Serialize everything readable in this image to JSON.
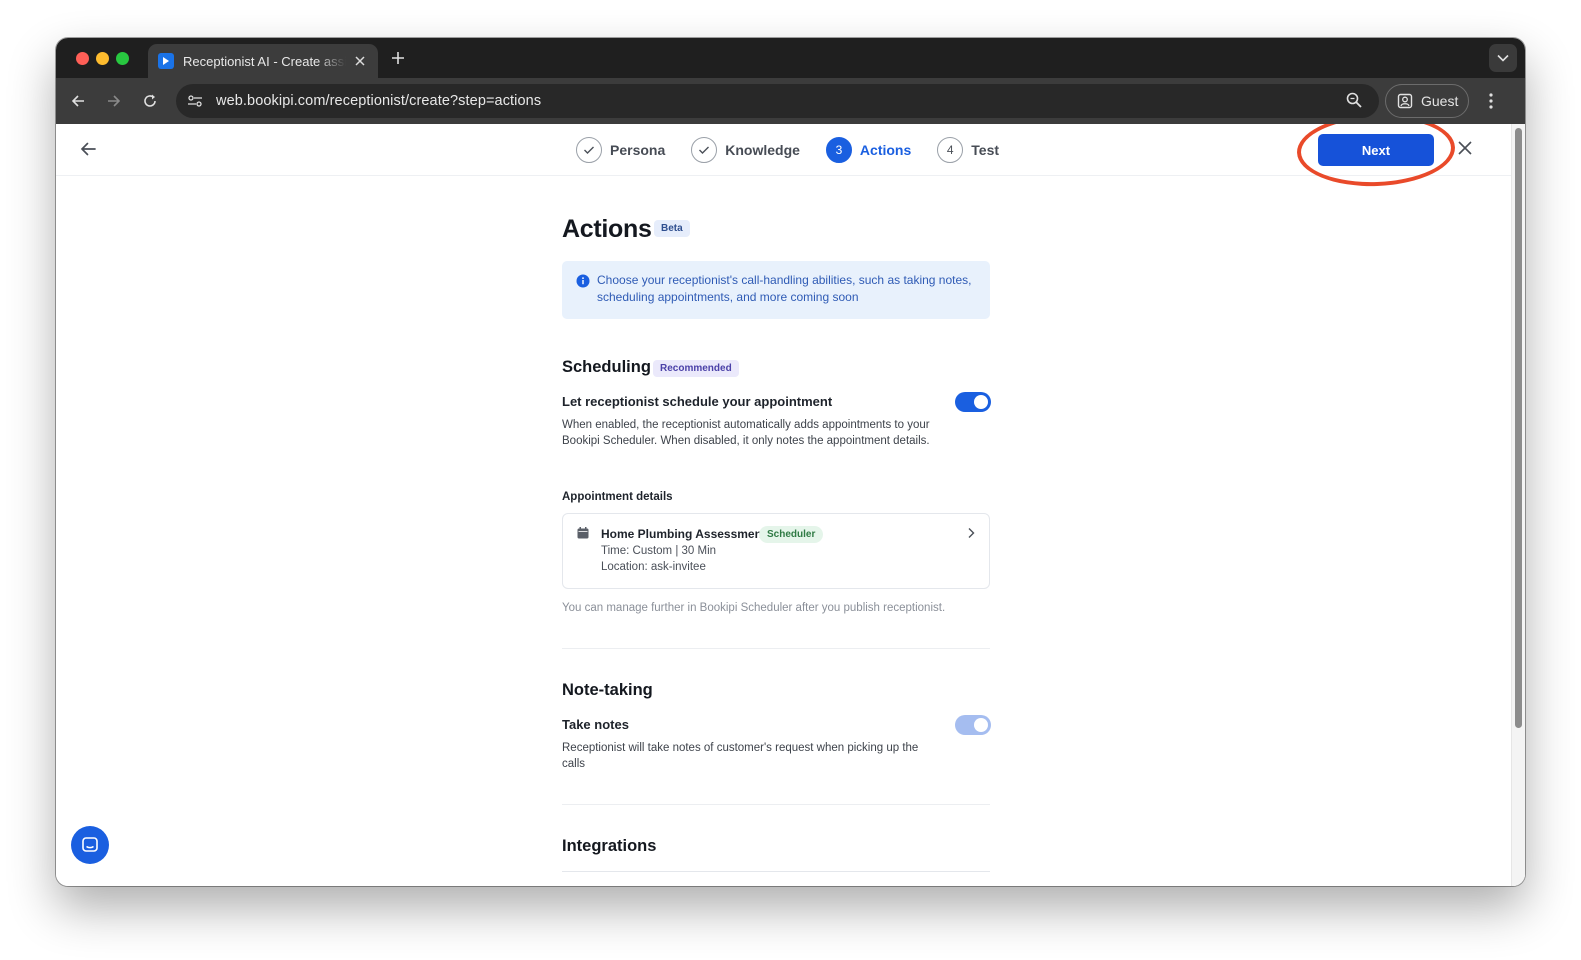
{
  "browser": {
    "tab_title": "Receptionist AI - Create assistant",
    "url": "web.bookipi.com/receptionist/create?step=actions",
    "profile_label": "Guest"
  },
  "stepper": {
    "steps": [
      {
        "number": "1",
        "label": "Persona",
        "state": "done"
      },
      {
        "number": "2",
        "label": "Knowledge",
        "state": "done"
      },
      {
        "number": "3",
        "label": "Actions",
        "state": "active"
      },
      {
        "number": "4",
        "label": "Test",
        "state": "pending"
      }
    ],
    "next_label": "Next"
  },
  "page": {
    "title": "Actions",
    "title_badge": "Beta",
    "info_text": "Choose your receptionist's call-handling abilities, such as taking notes, scheduling appointments, and more coming soon"
  },
  "scheduling": {
    "title": "Scheduling",
    "badge": "Recommended",
    "setting_title": "Let receptionist schedule your appointment",
    "setting_desc": "When enabled, the receptionist automatically adds appointments to your Bookipi Scheduler. When disabled, it only notes the appointment details.",
    "enabled": true,
    "details_heading": "Appointment details",
    "appointment": {
      "name": "Home Plumbing Assessment",
      "badge": "Scheduler",
      "time": "Time: Custom | 30 Min",
      "location": "Location: ask-invitee"
    },
    "footnote": "You can manage further in Bookipi Scheduler after you publish receptionist."
  },
  "note_taking": {
    "title": "Note-taking",
    "setting_title": "Take notes",
    "setting_desc": "Receptionist will take notes of customer's request when picking up the calls",
    "enabled": true
  },
  "integrations": {
    "title": "Integrations"
  },
  "colors": {
    "primary": "#1a5fe0",
    "next_button": "#1652d9",
    "highlight_ring": "#e94a2a",
    "info_bg": "#e8f1fc"
  }
}
